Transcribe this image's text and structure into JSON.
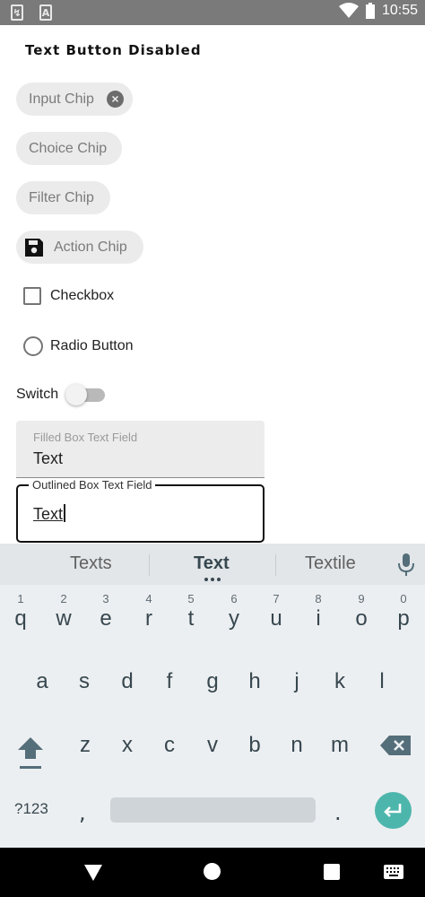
{
  "status_bar": {
    "time": "10:55",
    "notification_icons": [
      "sd-card-icon",
      "a-box-icon"
    ]
  },
  "screen": {
    "title": "Text Button Disabled",
    "chips": {
      "input": "Input Chip",
      "choice": "Choice Chip",
      "filter": "Filter Chip",
      "action": "Action Chip"
    },
    "checkbox_label": "Checkbox",
    "radio_label": "Radio Button",
    "switch_label": "Switch",
    "filled_field": {
      "label": "Filled Box Text Field",
      "value": "Text"
    },
    "outlined_field": {
      "label": "Outlined Box Text Field",
      "value": "Text"
    }
  },
  "keyboard": {
    "suggestions": [
      "Texts",
      "Text",
      "Textile"
    ],
    "row1": [
      {
        "k": "q",
        "n": "1"
      },
      {
        "k": "w",
        "n": "2"
      },
      {
        "k": "e",
        "n": "3"
      },
      {
        "k": "r",
        "n": "4"
      },
      {
        "k": "t",
        "n": "5"
      },
      {
        "k": "y",
        "n": "6"
      },
      {
        "k": "u",
        "n": "7"
      },
      {
        "k": "i",
        "n": "8"
      },
      {
        "k": "o",
        "n": "9"
      },
      {
        "k": "p",
        "n": "0"
      }
    ],
    "row2": [
      "a",
      "s",
      "d",
      "f",
      "g",
      "h",
      "j",
      "k",
      "l"
    ],
    "row3": [
      "z",
      "x",
      "c",
      "v",
      "b",
      "n",
      "m"
    ],
    "symbols_key": "?123",
    "comma_key": ",",
    "period_key": ".",
    "accent_color": "#4db6ac"
  }
}
